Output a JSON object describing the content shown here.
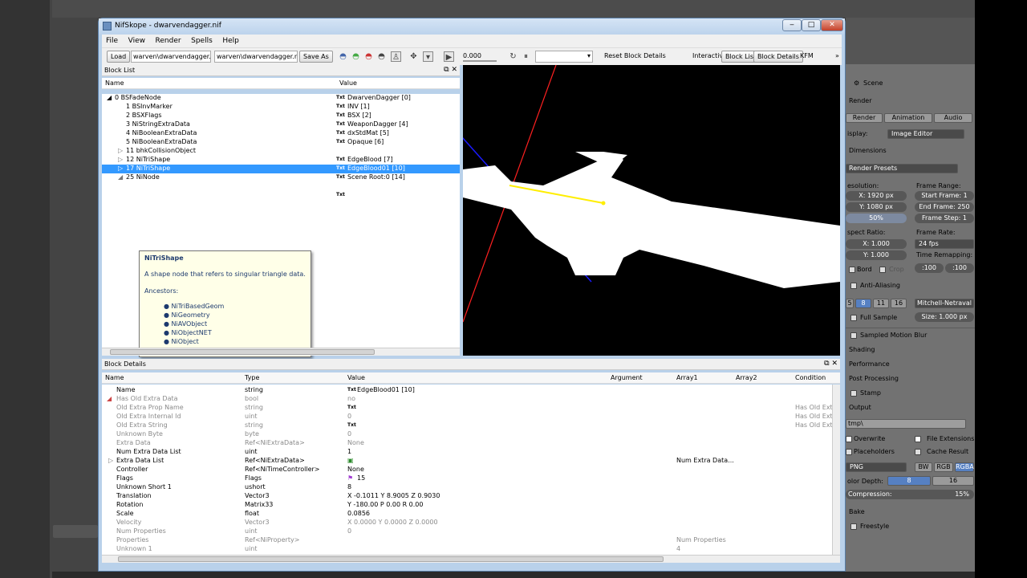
{
  "window": {
    "title": "NifSkope - dwarvendagger.nif"
  },
  "menu": [
    "File",
    "View",
    "Render",
    "Spells",
    "Help"
  ],
  "toolbar": {
    "load_label": "Load",
    "load_path": "warven\\dwarvendagger.nif",
    "save_path": "warven\\dwarvendagger.nif",
    "save_as_label": "Save As",
    "time_value": "0.000",
    "reset_label": "Reset Block Details",
    "help_label": "Interactive Help",
    "block_list_label": "Block List",
    "block_details_label": "Block Details",
    "kfm_label": "KFM"
  },
  "block_list": {
    "header": "Block List",
    "col_name": "Name",
    "col_value": "Value",
    "rows": [
      {
        "name": "0 BSFadeNode",
        "txt": "Txt",
        "value": "DwarvenDagger [0]"
      },
      {
        "name": "1 BSInvMarker",
        "txt": "Txt",
        "value": "INV [1]"
      },
      {
        "name": "2 BSXFlags",
        "txt": "Txt",
        "value": "BSX [2]"
      },
      {
        "name": "3 NiStringExtraData",
        "txt": "Txt",
        "value": "WeaponDagger [4]"
      },
      {
        "name": "4 NiBooleanExtraData",
        "txt": "Txt",
        "value": "dxStdMat [5]"
      },
      {
        "name": "5 NiBooleanExtraData",
        "txt": "Txt",
        "value": "Opaque [6]"
      },
      {
        "name": "11 bhkCollisionObject",
        "txt": "",
        "value": ""
      },
      {
        "name": "12 NiTriShape",
        "txt": "Txt",
        "value": "EdgeBlood [7]"
      },
      {
        "name": "17 NiTriShape",
        "txt": "Txt",
        "value": "EdgeBlood01 [10]"
      },
      {
        "name": "25 NiNode",
        "txt": "Txt",
        "value": "Scene Root:0 [14]"
      }
    ],
    "extra_txt": "Txt"
  },
  "tooltip": {
    "title": "NiTriShape",
    "description": "A shape node that refers to singular triangle data.",
    "ancestors_label": "Ancestors:",
    "ancestors": [
      "NiTriBasedGeom",
      "NiGeometry",
      "NiAVObject",
      "NiObjectNET",
      "NiObject"
    ]
  },
  "block_details": {
    "header": "Block Details",
    "columns": [
      "Name",
      "Type",
      "Value",
      "Argument",
      "Array1",
      "Array2",
      "Condition"
    ],
    "rows": [
      {
        "name": "Name",
        "type": "string",
        "txt": "Txt",
        "value": "EdgeBlood01 [10]",
        "array1": "",
        "cond": "",
        "grey": false
      },
      {
        "name": "Has Old Extra Data",
        "type": "bool",
        "txt": "",
        "value": "no",
        "array1": "",
        "cond": "",
        "grey": true
      },
      {
        "name": "Old Extra Prop Name",
        "type": "string",
        "txt": "Txt",
        "value": "",
        "array1": "",
        "cond": "Has Old Ext",
        "grey": true
      },
      {
        "name": "Old Extra Internal Id",
        "type": "uint",
        "txt": "",
        "value": "0",
        "array1": "",
        "cond": "Has Old Ext",
        "grey": true
      },
      {
        "name": "Old Extra String",
        "type": "string",
        "txt": "Txt",
        "value": "",
        "array1": "",
        "cond": "Has Old Ext",
        "grey": true
      },
      {
        "name": "Unknown Byte",
        "type": "byte",
        "txt": "",
        "value": "0",
        "array1": "",
        "cond": "",
        "grey": true
      },
      {
        "name": "Extra Data",
        "type": "Ref<NiExtraData>",
        "txt": "",
        "value": "None",
        "array1": "",
        "cond": "",
        "grey": true
      },
      {
        "name": "Num Extra Data List",
        "type": "uint",
        "txt": "",
        "value": "1",
        "array1": "",
        "cond": "",
        "grey": false
      },
      {
        "name": "Extra Data List",
        "type": "Ref<NiExtraData>",
        "txt": "",
        "value": "",
        "array1": "Num Extra Data...",
        "cond": "",
        "grey": false
      },
      {
        "name": "Controller",
        "type": "Ref<NiTimeController>",
        "txt": "",
        "value": "None",
        "array1": "",
        "cond": "",
        "grey": false
      },
      {
        "name": "Flags",
        "type": "Flags",
        "txt": "",
        "value": "15",
        "array1": "",
        "cond": "",
        "grey": false
      },
      {
        "name": "Unknown Short 1",
        "type": "ushort",
        "txt": "",
        "value": "8",
        "array1": "",
        "cond": "",
        "grey": false
      },
      {
        "name": "Translation",
        "type": "Vector3",
        "txt": "",
        "value": "X -0.1011 Y 8.9005 Z 0.9030",
        "array1": "",
        "cond": "",
        "grey": false
      },
      {
        "name": "Rotation",
        "type": "Matrix33",
        "txt": "",
        "value": "Y -180.00 P 0.00 R 0.00",
        "array1": "",
        "cond": "",
        "grey": false
      },
      {
        "name": "Scale",
        "type": "float",
        "txt": "",
        "value": "0.0856",
        "array1": "",
        "cond": "",
        "grey": false
      },
      {
        "name": "Velocity",
        "type": "Vector3",
        "txt": "",
        "value": "X 0.0000 Y 0.0000 Z 0.0000",
        "array1": "",
        "cond": "",
        "grey": true
      },
      {
        "name": "Num Properties",
        "type": "uint",
        "txt": "",
        "value": "0",
        "array1": "",
        "cond": "",
        "grey": true
      },
      {
        "name": "Properties",
        "type": "Ref<NiProperty>",
        "txt": "",
        "value": "",
        "array1": "Num Properties",
        "cond": "",
        "grey": true
      },
      {
        "name": "Unknown 1",
        "type": "uint",
        "txt": "",
        "value": "",
        "array1": "4",
        "cond": "",
        "grey": true
      }
    ]
  },
  "blender": {
    "scene": "Scene",
    "render": "Render",
    "tab_render": "Render",
    "tab_animation": "Animation",
    "tab_audio": "Audio",
    "display_label": "isplay:",
    "display_value": "Image Editor",
    "dimensions": "Dimensions",
    "render_presets": "Render Presets",
    "resolution": "esolution:",
    "frame_range": "Frame Range:",
    "res_x": "X:   1920 px",
    "res_y": "Y:   1080 px",
    "res_pct": "50%",
    "start_frame": "Start Frame:   1",
    "end_frame": "End Frame:  250",
    "frame_step": "Frame Step:   1",
    "aspect_ratio": "spect Ratio:",
    "frame_rate": "Frame Rate:",
    "aspect_x": "X:   1.000",
    "aspect_y": "Y:   1.000",
    "fps": "24 fps",
    "time_remap": "Time Remapping:",
    "remap_old": ":100",
    "remap_new": ":100",
    "border": "Bord",
    "crop": "Crop",
    "anti_aliasing": "Anti-Aliasing",
    "aa_5": "5",
    "aa_8": "8",
    "aa_11": "11",
    "aa_16": "16",
    "aa_filter": "Mitchell-Netraval",
    "full_sample": "Full Sample",
    "aa_size": "Size:  1.000 px",
    "motion_blur": "Sampled Motion Blur",
    "shading": "Shading",
    "performance": "Performance",
    "post_processing": "Post Processing",
    "stamp": "Stamp",
    "output": "Output",
    "output_path": "tmp\\",
    "overwrite": "Overwrite",
    "file_extensions": "File Extensions",
    "placeholders": "Placeholders",
    "cache_result": "Cache Result",
    "format": "PNG",
    "bw": "BW",
    "rgb": "RGB",
    "rgba": "RGBA",
    "color_depth": "olor Depth:",
    "depth_8": "8",
    "depth_16": "16",
    "compression": "Compression:",
    "compression_val": "15%",
    "bake": "Bake",
    "freestyle": "Freestyle"
  }
}
